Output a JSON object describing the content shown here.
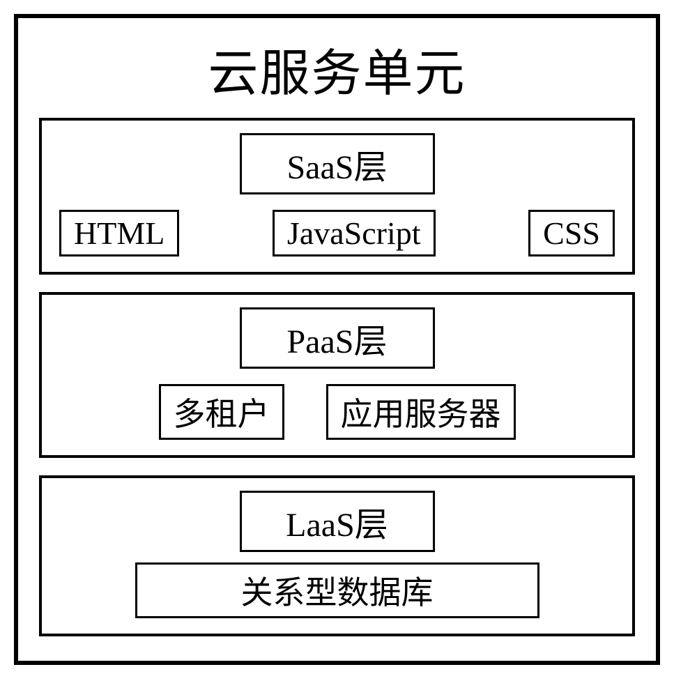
{
  "title": "云服务单元",
  "layers": [
    {
      "name": "SaaS层",
      "items": [
        "HTML",
        "JavaScript",
        "CSS"
      ]
    },
    {
      "name": "PaaS层",
      "items": [
        "多租户",
        "应用服务器"
      ]
    },
    {
      "name": "LaaS层",
      "items": [
        "关系型数据库"
      ]
    }
  ]
}
